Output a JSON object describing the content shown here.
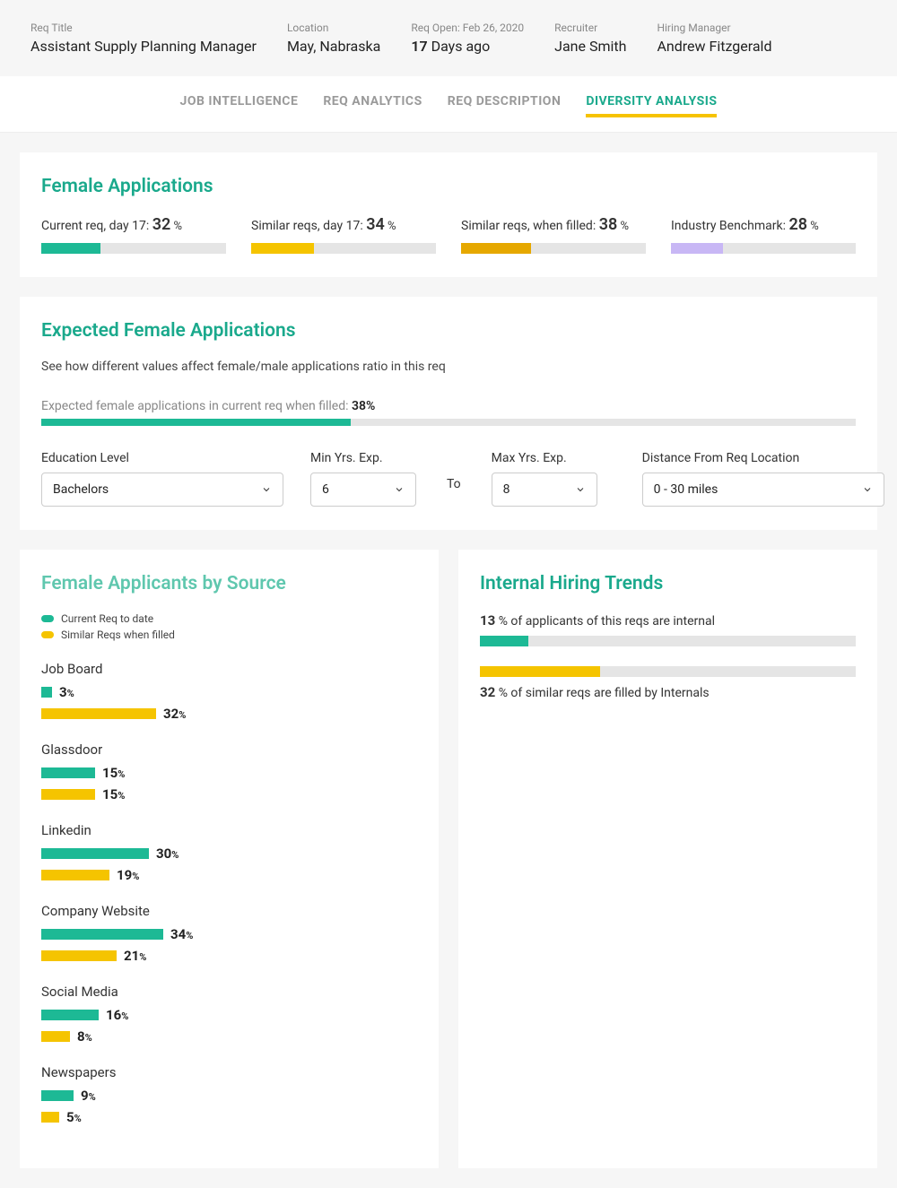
{
  "header": {
    "req_title_label": "Req Title",
    "req_title_value": "Assistant Supply Planning Manager",
    "location_label": "Location",
    "location_value": "May, Nabraska",
    "req_open_label": "Req Open: Feb 26, 2020",
    "req_open_days_num": "17",
    "req_open_days_text": " Days ago",
    "recruiter_label": "Recruiter",
    "recruiter_value": "Jane Smith",
    "hiring_manager_label": "Hiring Manager",
    "hiring_manager_value": "Andrew Fitzgerald"
  },
  "tabs": {
    "job_intelligence": "JOB INTELLIGENCE",
    "req_analytics": "REQ ANALYTICS",
    "req_description": "REQ DESCRIPTION",
    "diversity_analysis": "DIVERSITY ANALYSIS"
  },
  "female_apps": {
    "title": "Female Applications",
    "items": [
      {
        "label_prefix": "Current req, day 17: ",
        "pct": "32",
        "color": "fill-teal"
      },
      {
        "label_prefix": "Similar reqs, day 17: ",
        "pct": "34",
        "color": "fill-yellow"
      },
      {
        "label_prefix": "Similar reqs, when filled: ",
        "pct": "38",
        "color": "fill-orange"
      },
      {
        "label_prefix": "Industry Benchmark: ",
        "pct": "28",
        "color": "fill-purple"
      }
    ]
  },
  "expected": {
    "title": "Expected Female Applications",
    "subtitle": "See how different values affect female/male applications ratio in this req",
    "line_prefix": "Expected female applications in current req when filled: ",
    "line_value": "38%",
    "bar_pct": 38,
    "education_label": "Education Level",
    "education_value": "Bachelors",
    "min_label": "Min Yrs. Exp.",
    "min_value": "6",
    "to_label": "To",
    "max_label": "Max Yrs. Exp.",
    "max_value": "8",
    "distance_label": "Distance From Req Location",
    "distance_value": "0 - 30 miles"
  },
  "by_source": {
    "title": "Female Applicants by Source",
    "legend_current": "Current Req to date",
    "legend_similar": "Similar Reqs when filled",
    "sources": [
      {
        "name": "Job Board",
        "current": 3,
        "similar": 32
      },
      {
        "name": "Glassdoor",
        "current": 15,
        "similar": 15
      },
      {
        "name": "Linkedin",
        "current": 30,
        "similar": 19
      },
      {
        "name": "Company Website",
        "current": 34,
        "similar": 21
      },
      {
        "name": "Social Media",
        "current": 16,
        "similar": 8
      },
      {
        "name": "Newspapers",
        "current": 9,
        "similar": 5
      }
    ],
    "bar_scale": 4
  },
  "internal_trends": {
    "title": "Internal Hiring Trends",
    "line1_pct": "13",
    "line1_text": " % of applicants of this reqs are internal",
    "line1_color": "fill-teal",
    "line2_pct": "32",
    "line2_text": " % of similar reqs are filled by Internals",
    "line2_color": "fill-yellow"
  },
  "chart_data": [
    {
      "type": "bar",
      "title": "Female Applications",
      "categories": [
        "Current req, day 17",
        "Similar reqs, day 17",
        "Similar reqs, when filled",
        "Industry Benchmark"
      ],
      "values": [
        32,
        34,
        38,
        28
      ],
      "ylabel": "%",
      "ylim": [
        0,
        100
      ]
    },
    {
      "type": "bar",
      "title": "Expected Female Applications (filled)",
      "categories": [
        "Expected when filled"
      ],
      "values": [
        38
      ],
      "ylabel": "%",
      "ylim": [
        0,
        100
      ]
    },
    {
      "type": "bar",
      "title": "Female Applicants by Source",
      "categories": [
        "Job Board",
        "Glassdoor",
        "Linkedin",
        "Company Website",
        "Social Media",
        "Newspapers"
      ],
      "series": [
        {
          "name": "Current Req to date",
          "values": [
            3,
            15,
            30,
            34,
            16,
            9
          ]
        },
        {
          "name": "Similar Reqs when filled",
          "values": [
            32,
            15,
            19,
            21,
            8,
            5
          ]
        }
      ],
      "ylabel": "%",
      "ylim": [
        0,
        100
      ]
    },
    {
      "type": "bar",
      "title": "Internal Hiring Trends",
      "categories": [
        "Applicants of this req internal",
        "Similar reqs filled by internals"
      ],
      "values": [
        13,
        32
      ],
      "ylabel": "%",
      "ylim": [
        0,
        100
      ]
    }
  ]
}
